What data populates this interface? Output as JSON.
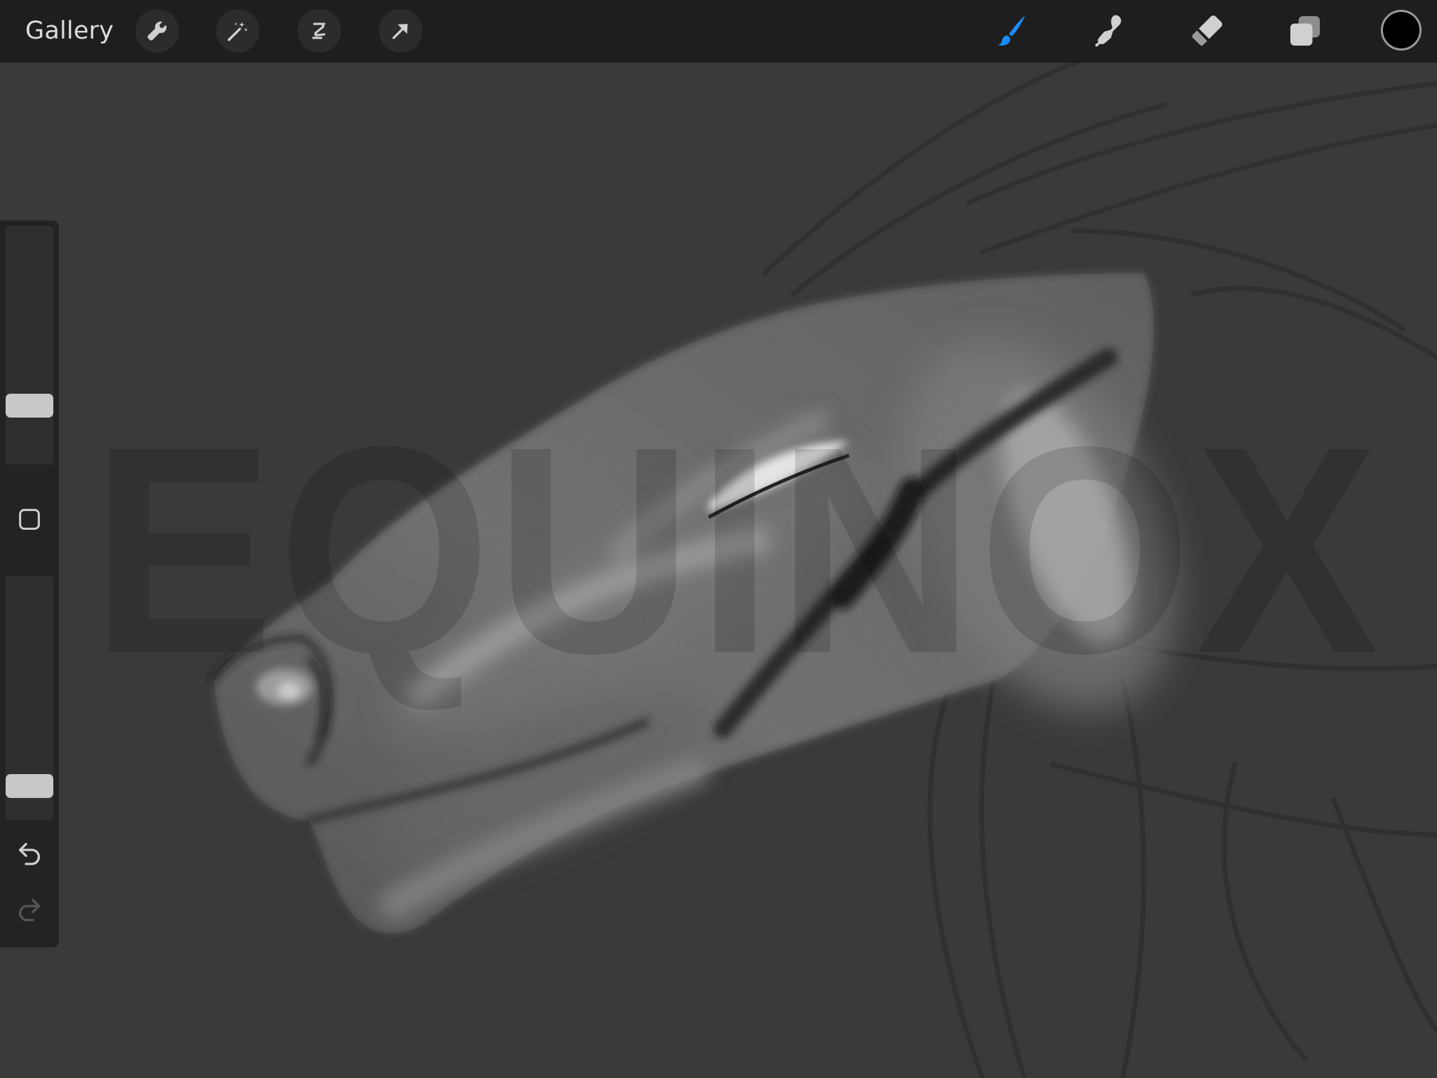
{
  "toolbar": {
    "gallery_label": "Gallery",
    "left_tools": [
      "actions",
      "adjustments",
      "selection",
      "transform"
    ],
    "right_tools": [
      "brush",
      "smudge",
      "eraser",
      "layers"
    ],
    "active_tool": "brush",
    "accent_color": "#1a8cff",
    "current_color": "#000000"
  },
  "canvas": {
    "watermark_text": "EQUINOX",
    "background_color": "#3a3a3a"
  },
  "sidebar": {
    "brush_size_level": 0.22,
    "opacity_level": 0.1,
    "controls": [
      "brush-size-slider",
      "modify-button",
      "opacity-slider",
      "undo-button",
      "redo-button"
    ]
  }
}
